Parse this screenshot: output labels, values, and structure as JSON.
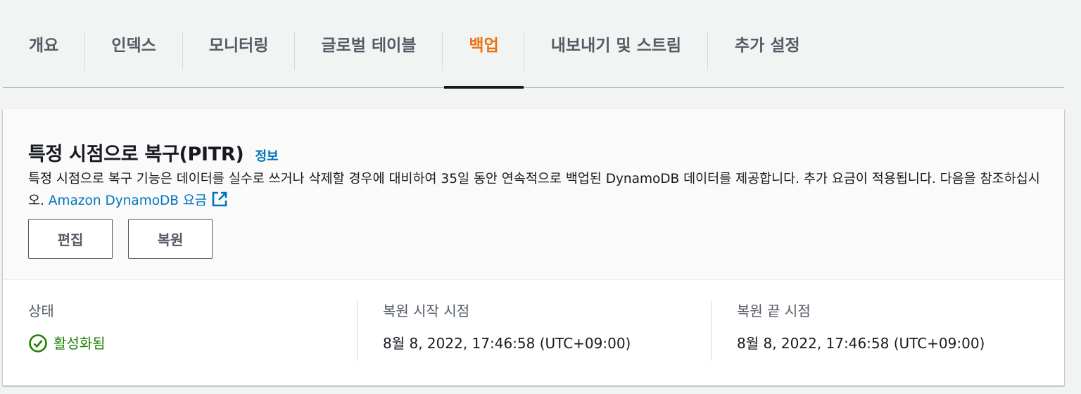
{
  "tabs": [
    {
      "label": "개요",
      "active": false
    },
    {
      "label": "인덱스",
      "active": false
    },
    {
      "label": "모니터링",
      "active": false
    },
    {
      "label": "글로벌 테이블",
      "active": false
    },
    {
      "label": "백업",
      "active": true
    },
    {
      "label": "내보내기 및 스트림",
      "active": false
    },
    {
      "label": "추가 설정",
      "active": false
    }
  ],
  "pitr": {
    "title": "특정 시점으로 복구(PITR)",
    "info_link": "정보",
    "description": "특정 시점으로 복구 기능은 데이터를 실수로 쓰거나 삭제할 경우에 대비하여 35일 동안 연속적으로 백업된 DynamoDB 데이터를 제공합니다. 추가 요금이 적용됩니다. 다음을 참조하십시오.",
    "pricing_link": "Amazon DynamoDB 요금",
    "edit_button": "편집",
    "restore_button": "복원"
  },
  "details": {
    "status_label": "상태",
    "status_value": "활성화됨",
    "restore_start_label": "복원 시작 시점",
    "restore_start_value": "8월 8, 2022, 17:46:58 (UTC+09:00)",
    "restore_end_label": "복원 끝 시점",
    "restore_end_value": "8월 8, 2022, 17:46:58 (UTC+09:00)"
  },
  "colors": {
    "accent": "#ec7211",
    "link": "#0073bb",
    "success": "#1d8102"
  },
  "icons": {
    "external_link": "external-link-icon",
    "status": "check-circle-icon"
  }
}
